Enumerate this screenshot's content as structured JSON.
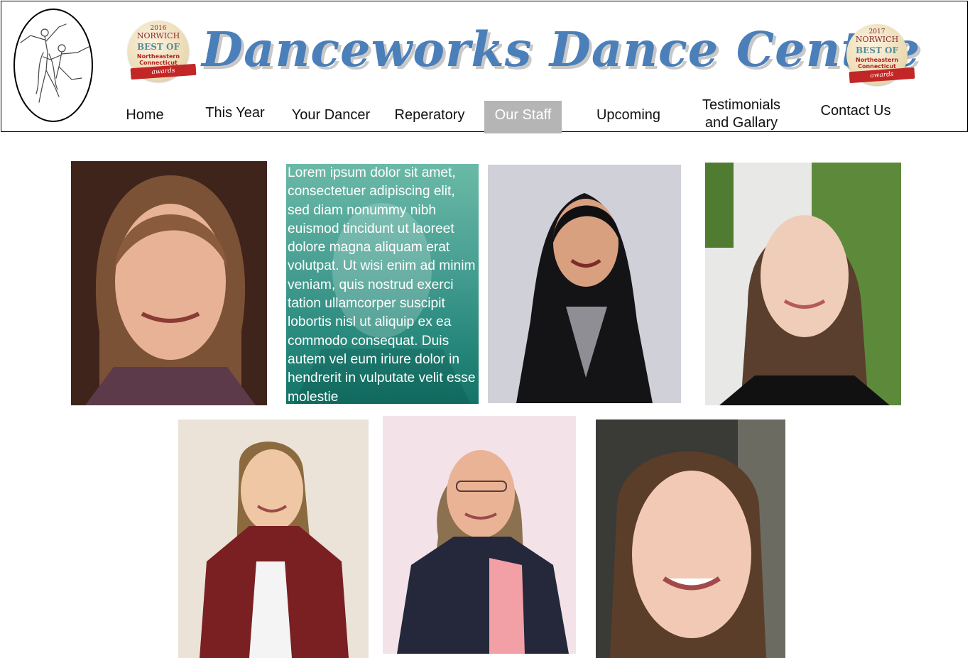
{
  "header": {
    "site_title": "Danceworks Dance Centre",
    "badge_left": {
      "year": "2016",
      "publisher": "NORWICH",
      "line1": "BEST OF",
      "line2": "Northeastern Connecticut",
      "ribbon": "awards"
    },
    "badge_right": {
      "year": "2017",
      "publisher": "NORWICH",
      "line1": "BEST OF",
      "line2": "Northeastern Connecticut",
      "ribbon": "awards"
    }
  },
  "nav": {
    "home": "Home",
    "this_year": "This Year",
    "your_dancer": "Your Dancer",
    "repertory": "Reperatory",
    "our_staff": "Our Staff",
    "upcoming": "Upcoming",
    "testimonials_line1": "Testimonials",
    "testimonials_line2": "and Gallary",
    "contact": "Contact Us",
    "active_item": "Our Staff"
  },
  "staff": {
    "bio_text": "Lorem ipsum dolor sit amet, consectetuer adipiscing elit, sed diam nonummy nibh euismod tincidunt ut laoreet dolore magna aliquam erat volutpat. Ut wisi enim ad minim veniam, quis nostrud exerci tation ullamcorper suscipit lobortis nisl ut aliquip ex ea commodo consequat. Duis autem vel eum iriure dolor in hendrerit in vulputate velit esse molestie"
  },
  "colors": {
    "title": "#4a7fb9",
    "nav_active_bg": "#b5b5b5",
    "bio_overlay": "#26877b",
    "badge_ribbon": "#c22626"
  }
}
